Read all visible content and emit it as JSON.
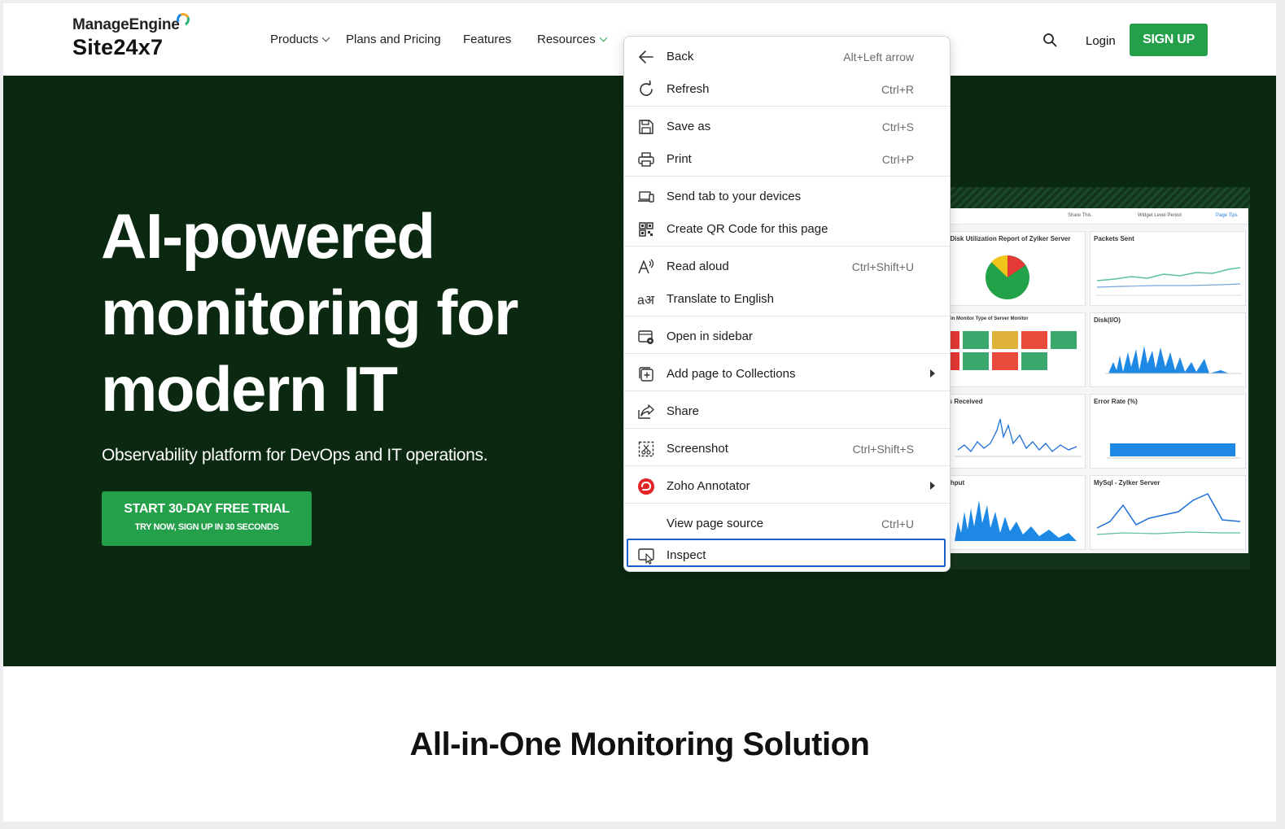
{
  "header": {
    "logo_top": "ManageEngine",
    "logo_bottom": "Site24x7",
    "nav": [
      {
        "label": "Products"
      },
      {
        "label": "Plans and Pricing"
      },
      {
        "label": "Features"
      },
      {
        "label": "Resources"
      }
    ],
    "login": "Login",
    "signup": "SIGN UP"
  },
  "hero": {
    "title_line1": "AI-powered",
    "title_line2": "monitoring for",
    "title_line3": "modern IT",
    "subtitle": "Observability platform for DevOps and IT operations.",
    "cta_main": "START 30-DAY FREE TRIAL",
    "cta_sub": "TRY NOW, SIGN UP IN 30 SECONDS"
  },
  "dashboard": {
    "toolbar": [
      "Share This",
      "Widget Level Period",
      "Page Tips"
    ],
    "panels": [
      {
        "title": "l Disk Utilization Report of Zylker Server"
      },
      {
        "title": "Packets Sent"
      },
      {
        "title": "s in Monitor Type of Server Monitor"
      },
      {
        "title": "Disk(I/O)"
      },
      {
        "title": "ts Received"
      },
      {
        "title": "Error Rate (%)"
      },
      {
        "title": "ghput"
      },
      {
        "title": "MySql - Zylker Server"
      }
    ]
  },
  "bottom": {
    "title": "All-in-One Monitoring Solution"
  },
  "context_menu": {
    "items": [
      {
        "label": "Back",
        "shortcut": "Alt+Left arrow",
        "icon": "back-arrow-icon"
      },
      {
        "label": "Refresh",
        "shortcut": "Ctrl+R",
        "icon": "refresh-icon"
      },
      {
        "label": "Save as",
        "shortcut": "Ctrl+S",
        "icon": "save-icon"
      },
      {
        "label": "Print",
        "shortcut": "Ctrl+P",
        "icon": "print-icon"
      },
      {
        "label": "Send tab to your devices",
        "shortcut": "",
        "icon": "devices-icon"
      },
      {
        "label": "Create QR Code for this page",
        "shortcut": "",
        "icon": "qr-code-icon"
      },
      {
        "label": "Read aloud",
        "shortcut": "Ctrl+Shift+U",
        "icon": "read-aloud-icon"
      },
      {
        "label": "Translate to English",
        "shortcut": "",
        "icon": "translate-icon"
      },
      {
        "label": "Open in sidebar",
        "shortcut": "",
        "icon": "sidebar-icon"
      },
      {
        "label": "Add page to Collections",
        "shortcut": "",
        "icon": "collections-icon",
        "submenu": true
      },
      {
        "label": "Share",
        "shortcut": "",
        "icon": "share-icon"
      },
      {
        "label": "Screenshot",
        "shortcut": "Ctrl+Shift+S",
        "icon": "screenshot-icon"
      },
      {
        "label": "Zoho Annotator",
        "shortcut": "",
        "icon": "zoho-annotator-icon",
        "submenu": true
      },
      {
        "label": "View page source",
        "shortcut": "Ctrl+U",
        "icon": ""
      },
      {
        "label": "Inspect",
        "shortcut": "",
        "icon": "inspect-icon",
        "focused": true
      }
    ]
  },
  "colors": {
    "brand_green": "#23a049",
    "hero_bg": "#0b2911",
    "focus_blue": "#1a5fd1"
  }
}
